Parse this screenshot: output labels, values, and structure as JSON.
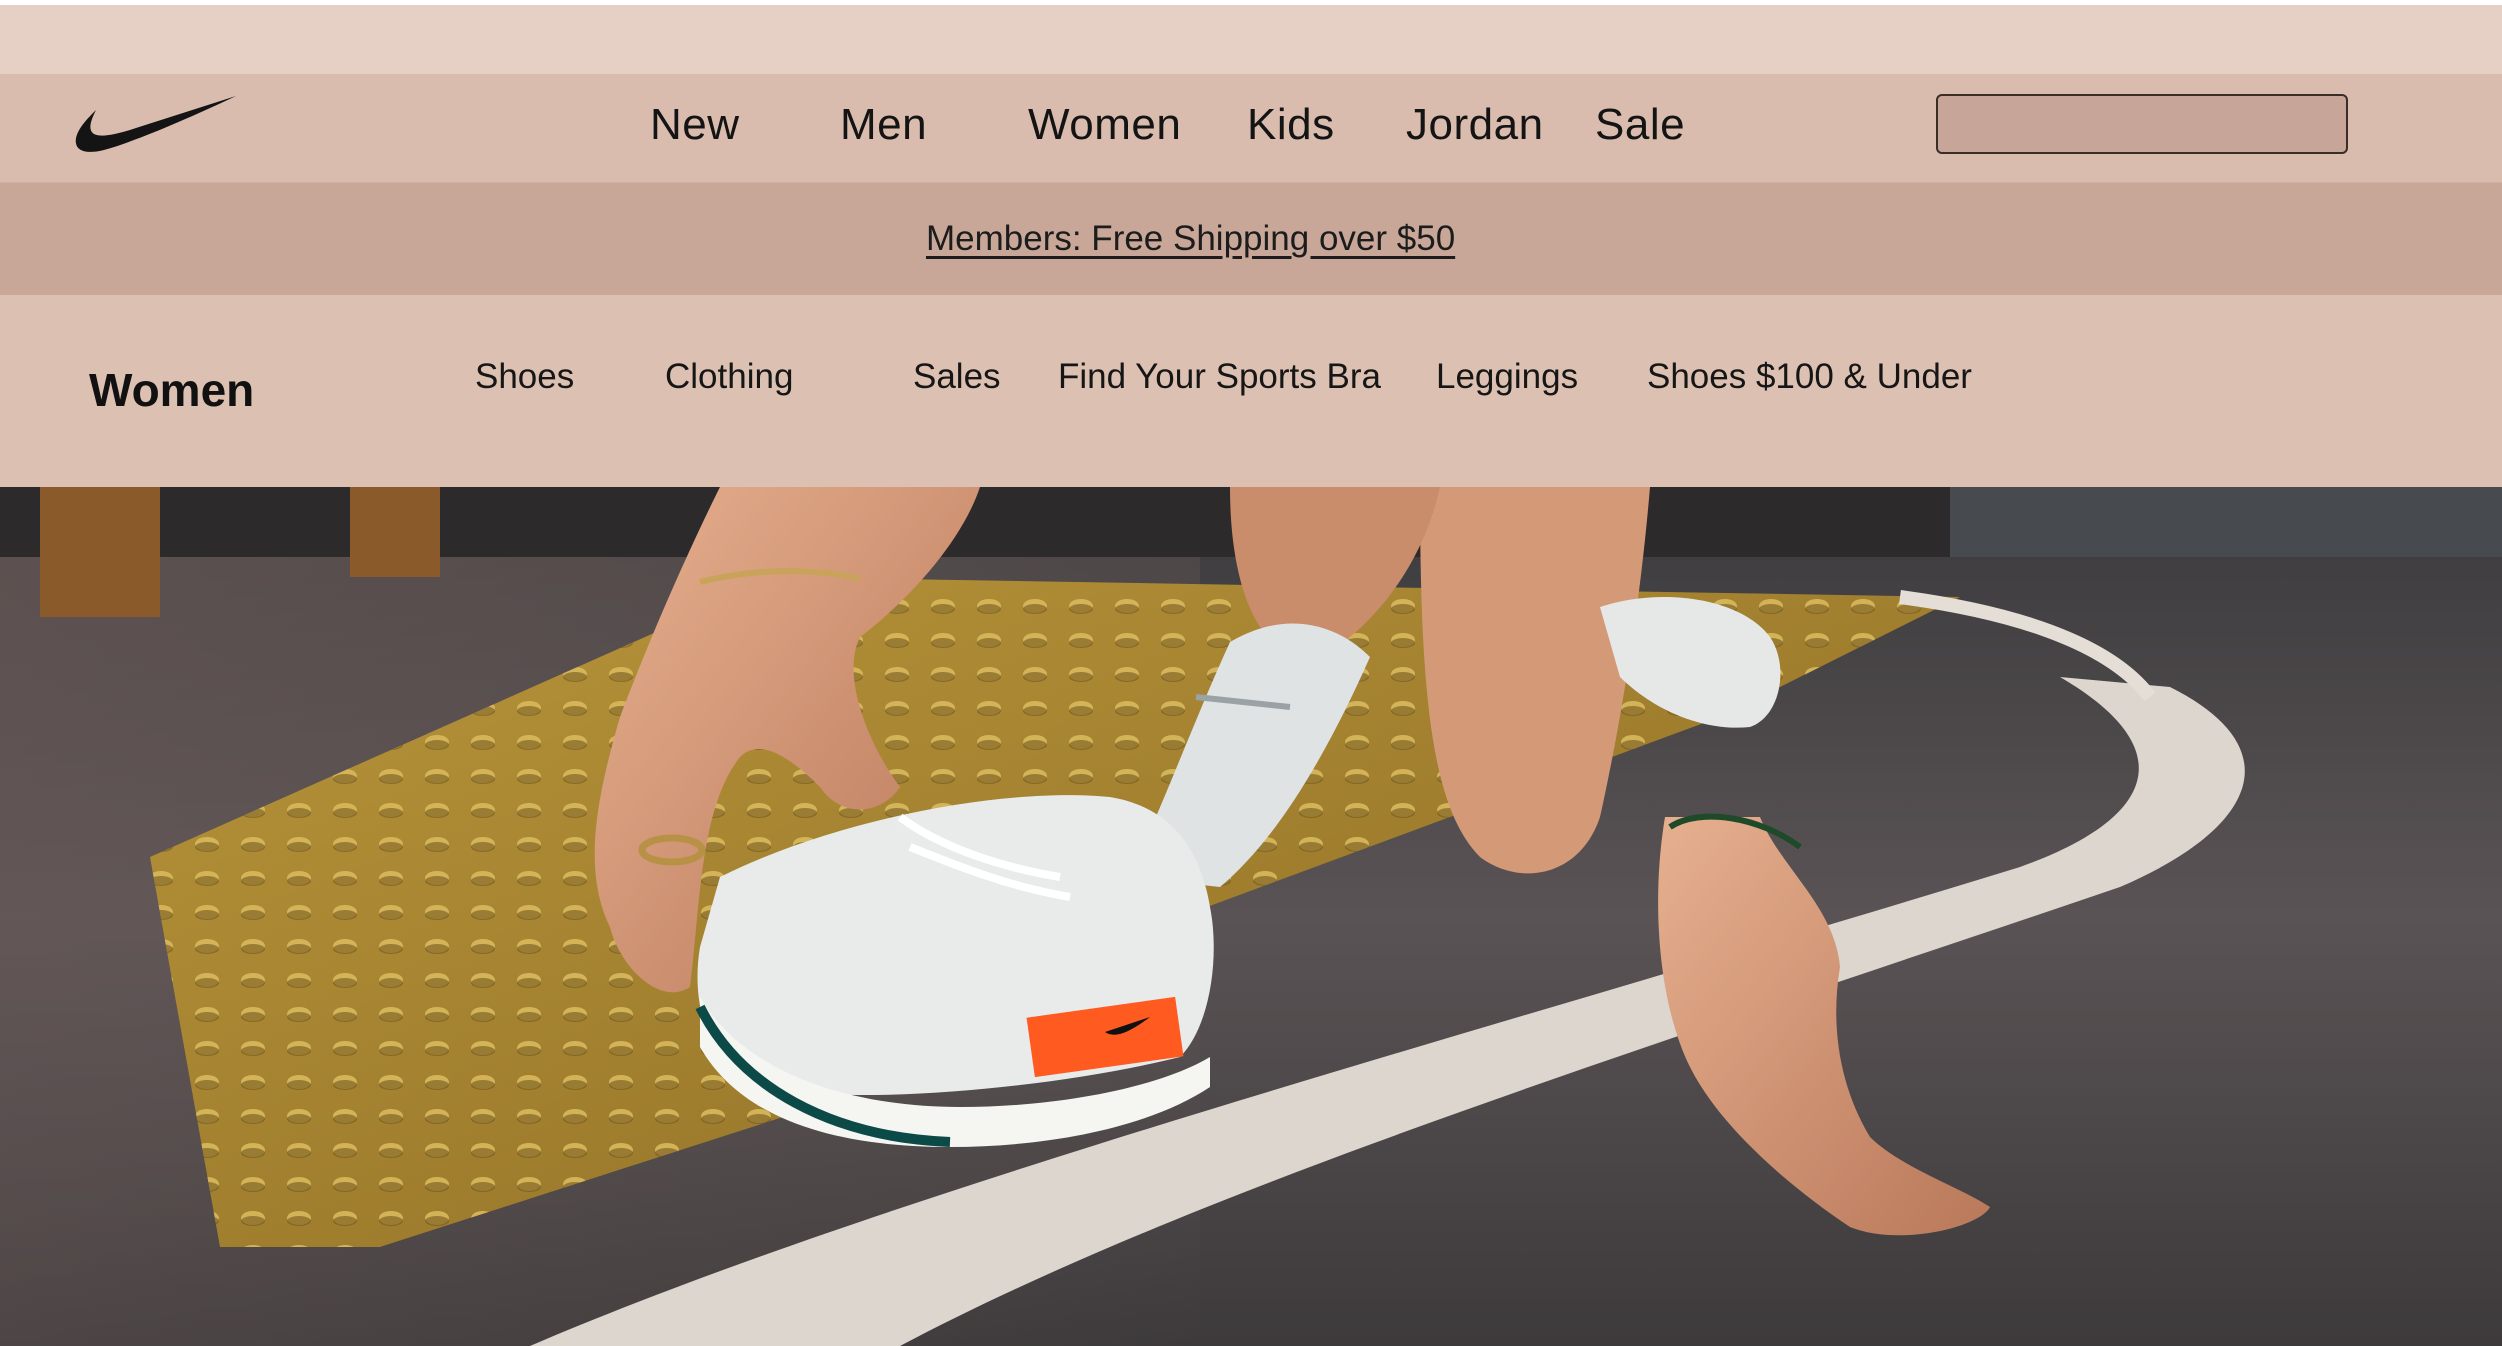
{
  "header": {
    "logo": "swoosh-logo",
    "nav": [
      "New",
      "Men",
      "Women",
      "Kids",
      "Jordan",
      "Sale"
    ],
    "search": {
      "value": "",
      "placeholder": ""
    }
  },
  "promo": {
    "text": "Members: Free Shipping over $50"
  },
  "subnav": {
    "title": "Women",
    "items": [
      "Shoes",
      "Clothing",
      "Sales",
      "Find Your Sports Bra",
      "Leggings",
      "Shoes $100 &  Under"
    ]
  },
  "hero": {
    "image": "runner-tying-shoe-photo"
  },
  "colors": {
    "topstrip": "#e6d0c5",
    "header": "#d9bcae",
    "promo": "#c8a799",
    "subnav": "#dcc0b2",
    "search_bg": "#c7a699",
    "shoe_accent": "#ff5a1f"
  }
}
